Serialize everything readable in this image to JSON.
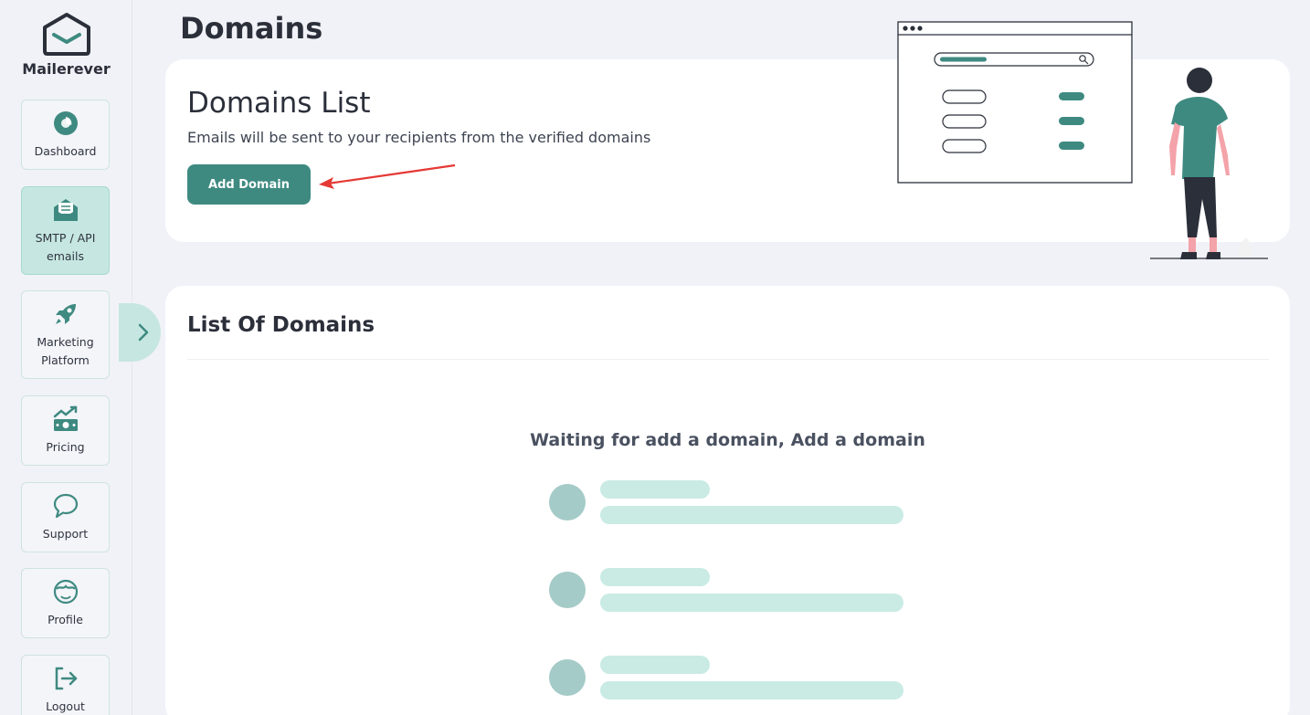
{
  "app": {
    "name": "Mailerever"
  },
  "colors": {
    "accent": "#3e8a81",
    "active_nav": "#c6e7e1",
    "skeleton": "#c9ebe4"
  },
  "sidebar": {
    "items": [
      {
        "label": "Dashboard",
        "icon": "pie-chart-icon"
      },
      {
        "label": "SMTP / API emails",
        "icon": "mail-open-icon",
        "active": true
      },
      {
        "label": "Marketing Platform",
        "icon": "rocket-icon"
      },
      {
        "label": "Pricing",
        "icon": "money-chart-icon"
      },
      {
        "label": "Support",
        "icon": "chat-bubble-icon"
      },
      {
        "label": "Profile",
        "icon": "user-face-icon"
      },
      {
        "label": "Logout",
        "icon": "logout-icon"
      }
    ]
  },
  "page": {
    "title": "Domains"
  },
  "domains_card": {
    "title": "Domains List",
    "subtitle": "Emails will be sent to your recipients from the verified domains",
    "add_button": "Add Domain"
  },
  "list_card": {
    "title": "List Of Domains",
    "empty_message": "Waiting for add a domain, Add a domain"
  }
}
